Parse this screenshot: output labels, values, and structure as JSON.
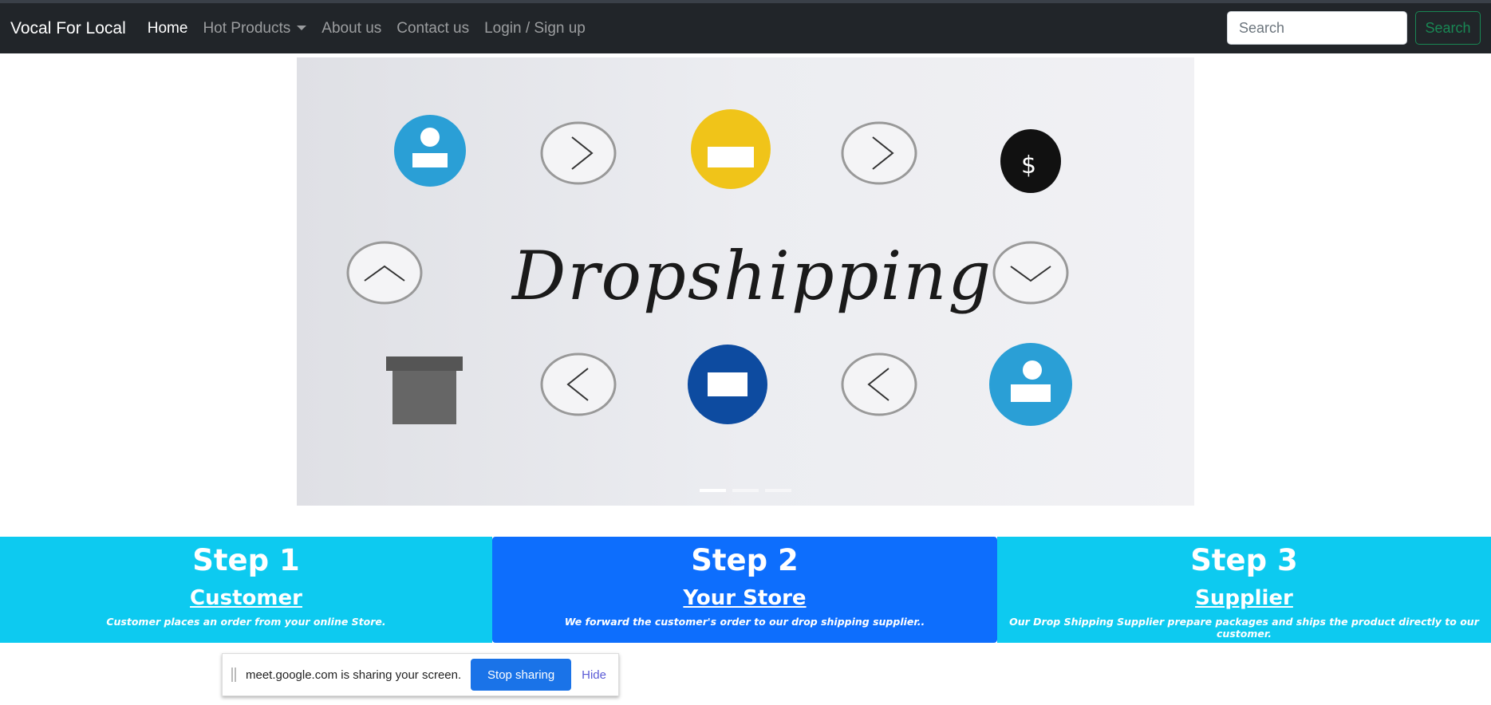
{
  "navbar": {
    "brand": "Vocal For Local",
    "links": [
      "Home",
      "Hot Products",
      "About us",
      "Contact us",
      "Login / Sign up"
    ],
    "search_placeholder": "Search",
    "search_button": "Search"
  },
  "carousel": {
    "image_text": "Dropshipping",
    "slide_count": 3,
    "active_slide": 1
  },
  "steps": [
    {
      "title": "Step 1",
      "link": "Customer",
      "description": "Customer places an order from your online Store.",
      "color": "#0dcaf0"
    },
    {
      "title": "Step 2",
      "link": "Your Store",
      "description": "We forward the customer's order to our drop shipping supplier..",
      "color": "#0d6efd"
    },
    {
      "title": "Step 3",
      "link": "Supplier",
      "description": "Our Drop Shipping Supplier prepare packages and ships the product directly to our customer.",
      "color": "#0dcaf0"
    }
  ],
  "share_bar": {
    "message": "meet.google.com is sharing your screen.",
    "stop_button": "Stop sharing",
    "hide_link": "Hide"
  }
}
